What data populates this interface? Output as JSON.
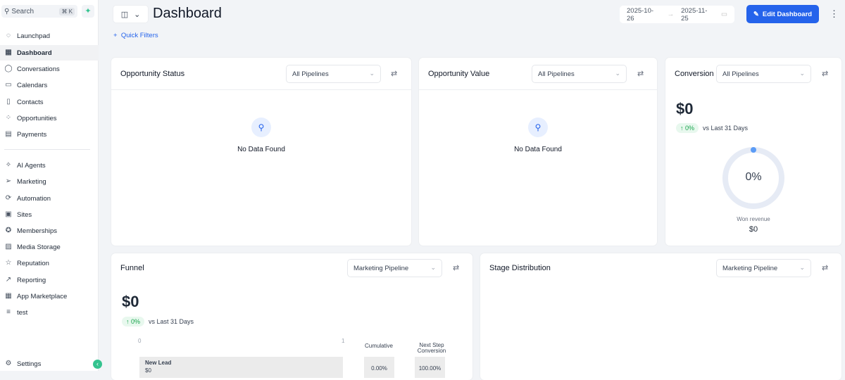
{
  "sidebar": {
    "search_label": "Search",
    "shortcut": "⌘ K",
    "items": [
      {
        "label": "Launchpad",
        "icon": "rocket-icon"
      },
      {
        "label": "Dashboard",
        "icon": "grid-icon"
      },
      {
        "label": "Conversations",
        "icon": "chat-icon"
      },
      {
        "label": "Calendars",
        "icon": "calendar-icon"
      },
      {
        "label": "Contacts",
        "icon": "contacts-icon"
      },
      {
        "label": "Opportunities",
        "icon": "opportunities-icon"
      },
      {
        "label": "Payments",
        "icon": "payments-icon"
      }
    ],
    "items2": [
      {
        "label": "AI Agents",
        "icon": "sparkle-icon"
      },
      {
        "label": "Marketing",
        "icon": "send-icon"
      },
      {
        "label": "Automation",
        "icon": "automation-icon"
      },
      {
        "label": "Sites",
        "icon": "sites-icon"
      },
      {
        "label": "Memberships",
        "icon": "badge-icon"
      },
      {
        "label": "Media Storage",
        "icon": "image-icon"
      },
      {
        "label": "Reputation",
        "icon": "star-icon"
      },
      {
        "label": "Reporting",
        "icon": "trend-icon"
      },
      {
        "label": "App Marketplace",
        "icon": "apps-icon"
      },
      {
        "label": "test",
        "icon": "list-icon"
      }
    ],
    "settings": "Settings"
  },
  "header": {
    "title": "Dashboard",
    "quick_filters": "Quick Filters",
    "date_start": "2025-10-26",
    "date_end": "2025-11-25",
    "edit": "Edit Dashboard"
  },
  "cards": {
    "opp_status": {
      "title": "Opportunity Status",
      "select": "All Pipelines",
      "empty": "No Data Found"
    },
    "opp_value": {
      "title": "Opportunity Value",
      "select": "All Pipelines",
      "empty": "No Data Found"
    },
    "conversion": {
      "title": "Conversion",
      "select": "All Pipelines",
      "value": "$0",
      "change": "↑ 0%",
      "compare": "vs Last 31 Days",
      "gauge": "0%",
      "gauge_fraction": 0,
      "won_label": "Won revenue",
      "won_value": "$0"
    },
    "funnel": {
      "title": "Funnel",
      "select": "Marketing Pipeline",
      "value": "$0",
      "change": "↑ 0%",
      "compare": "vs Last 31 Days",
      "axis_min": "0",
      "axis_max": "1",
      "col_cumulative": "Cumulative",
      "col_next": "Next Step Conversion",
      "stage": "New Lead",
      "stage_value": "$0",
      "cumulative": "0.00%",
      "next": "100.00%"
    },
    "stage_dist": {
      "title": "Stage Distribution",
      "select": "Marketing Pipeline"
    }
  }
}
